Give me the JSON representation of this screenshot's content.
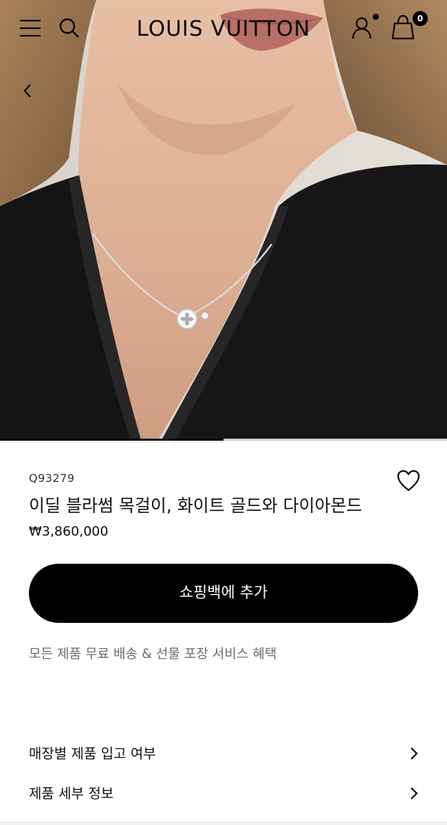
{
  "header": {
    "logo": "LOUIS VUITTON",
    "cart_count": "0",
    "icons": {
      "menu": "menu-icon",
      "search": "search-icon",
      "account": "account-icon",
      "bag": "shopping-bag-icon",
      "back": "chevron-left-icon"
    }
  },
  "gallery": {
    "progress_fraction": 0.5,
    "image": "model-wearing-necklace"
  },
  "product": {
    "sku": "Q93279",
    "title": "이딜 블라썸 목걸이, 화이트 골드와 다이아몬드",
    "price": "₩3,860,000",
    "add_to_bag_label": "쇼핑백에 추가",
    "benefit_text": "모든 제품 무료 배송 & 선물 포장 서비스 혜택",
    "wishlist_icon": "heart-icon"
  },
  "details": {
    "rows": [
      {
        "label": "매장별 제품 입고 여부",
        "icon": "chevron-right-icon"
      },
      {
        "label": "제품 세부 정보",
        "icon": "chevron-right-icon"
      }
    ]
  },
  "colors": {
    "primary": "#000000",
    "background": "#ffffff",
    "muted_text": "#6b6b6b"
  }
}
